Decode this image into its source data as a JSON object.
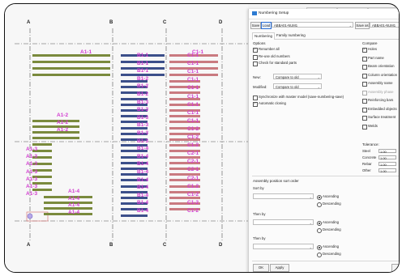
{
  "grid_labels": {
    "top": [
      "A",
      "B",
      "C",
      "D"
    ],
    "bottom": [
      "A",
      "B",
      "C",
      "D"
    ]
  },
  "marks": {
    "col_a_top": "A1-1",
    "col_b_top": "B1-1",
    "col_c_top": "C1-1",
    "col_a_mid": [
      "A1-2",
      "A1-2",
      "A1-2"
    ],
    "col_a_lower": [
      "A1-3",
      "A1-3",
      "A1-3",
      "A1-3",
      "A1-3",
      "A1-3",
      "A1-3"
    ],
    "col_a_bottom": [
      "A1-4",
      "A1-4",
      "A1-4",
      "A1-4"
    ],
    "col_b_list": [
      "B1-1",
      "B1-1",
      "B1-1",
      "B1-2",
      "B1-2",
      "B1-2",
      "B1-3",
      "B1-3",
      "B1-3",
      "B1-3",
      "B1-3",
      "B1-3",
      "B1-4",
      "B1-4",
      "B1-4",
      "B1-4",
      "B1-4",
      "B1-4",
      "B1-4",
      "B1-4",
      "B1-4"
    ],
    "col_c_list": [
      "C1-1",
      "C1-1",
      "C1-1",
      "C1-1",
      "C1-1",
      "C1-1",
      "C1-1",
      "C1-1",
      "C1-1",
      "C1-2",
      "C1-2",
      "C1-2",
      "C2-1",
      "C2-1",
      "C2-1",
      "C2-1",
      "C1-2",
      "C1-2",
      "C1-2",
      "C1-2"
    ]
  },
  "dialog": {
    "title": "Numbering Setup",
    "save_label": "Save",
    "load_label": "Load",
    "load_value": "ABBA01-NUM1",
    "save_as_label": "Save as",
    "save_as_value": "ABBA01-NUM1",
    "tabs": [
      "Numbering",
      "Family numbering"
    ],
    "options_heading": "Options",
    "options": [
      {
        "label": "Renumber all",
        "checked": true
      },
      {
        "label": "Re-use old numbers",
        "checked": false
      },
      {
        "label": "Check for standard parts",
        "checked": false
      }
    ],
    "new_label": "New:",
    "new_value": "Compare to old",
    "modified_label": "Modified:",
    "modified_value": "Compare to old",
    "sync_label": "Synchronize with master model (save-numbering-save)",
    "auto_clone_label": "Automatic cloning",
    "compare_heading": "Compare",
    "compare_items": [
      {
        "label": "Holes",
        "checked": true,
        "dim": false
      },
      {
        "label": "Part name",
        "checked": false,
        "dim": false
      },
      {
        "label": "Beam orientation",
        "checked": false,
        "dim": false
      },
      {
        "label": "Column orientation",
        "checked": false,
        "dim": false
      },
      {
        "label": "Assembly name",
        "checked": false,
        "dim": false
      },
      {
        "label": "Assembly phase",
        "checked": false,
        "dim": true
      },
      {
        "label": "Reinforcing bars",
        "checked": false,
        "dim": false
      },
      {
        "label": "Embedded objects",
        "checked": false,
        "dim": false
      },
      {
        "label": "Surface treatment",
        "checked": false,
        "dim": false
      },
      {
        "label": "Welds",
        "checked": false,
        "dim": false
      }
    ],
    "tolerance_heading": "Tolerance:",
    "tolerances": [
      {
        "label": "Steel",
        "value": "1.00"
      },
      {
        "label": "Concrete",
        "value": "1.00"
      },
      {
        "label": "Rebar",
        "value": "1.00"
      },
      {
        "label": "Other",
        "value": "1.00"
      }
    ],
    "sort_heading": "Assembly position sort order",
    "sort_by_label": "Sort by",
    "then_by_label": "Then by",
    "then_by_label_2": "Then by",
    "ascending": "Ascending",
    "descending": "Descending",
    "ok_label": "OK",
    "apply_label": "Apply"
  }
}
